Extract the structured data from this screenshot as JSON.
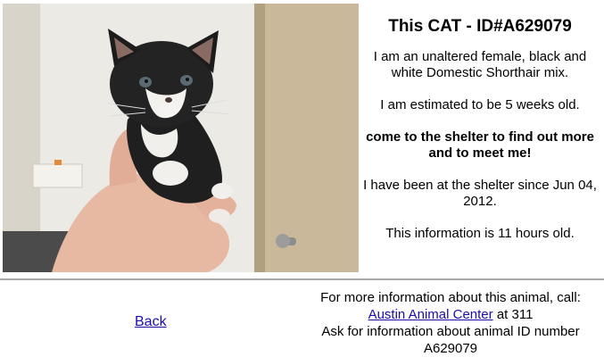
{
  "photo": {
    "alt_icon": "kitten-photo"
  },
  "info": {
    "title": "This CAT - ID#A629079",
    "description": "I am an unaltered female, black and white Domestic Shorthair mix.",
    "age": "I am estimated to be 5 weeks old.",
    "cta": "come to the shelter to find out more and to meet me!",
    "since": "I have been at the shelter since Jun 04, 2012.",
    "freshness": "This information is 11 hours old."
  },
  "footer": {
    "back_label": "Back",
    "more_info_prefix": "For more information about this animal, call:",
    "center_link": "Austin Animal Center",
    "phone_suffix": " at 311",
    "ask_text": "Ask for information about animal ID number",
    "animal_id": "A629079"
  },
  "colors": {
    "link": "#1a0dab",
    "divider": "#a8a8a8"
  }
}
